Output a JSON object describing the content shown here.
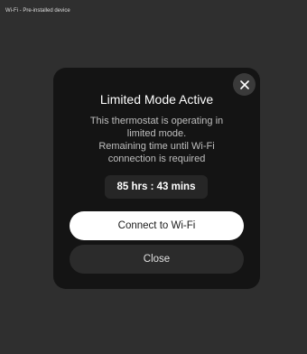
{
  "window": {
    "title": "Wi-Fi - Pre-installed device"
  },
  "modal": {
    "close_icon": "close-icon",
    "title": "Limited Mode Active",
    "message_lines": [
      "This thermostat is operating in",
      "limited mode.",
      "Remaining time until Wi-Fi",
      "connection is required"
    ],
    "remaining_time": "85 hrs : 43 mins",
    "primary_button": "Connect to Wi-Fi",
    "secondary_button": "Close"
  }
}
